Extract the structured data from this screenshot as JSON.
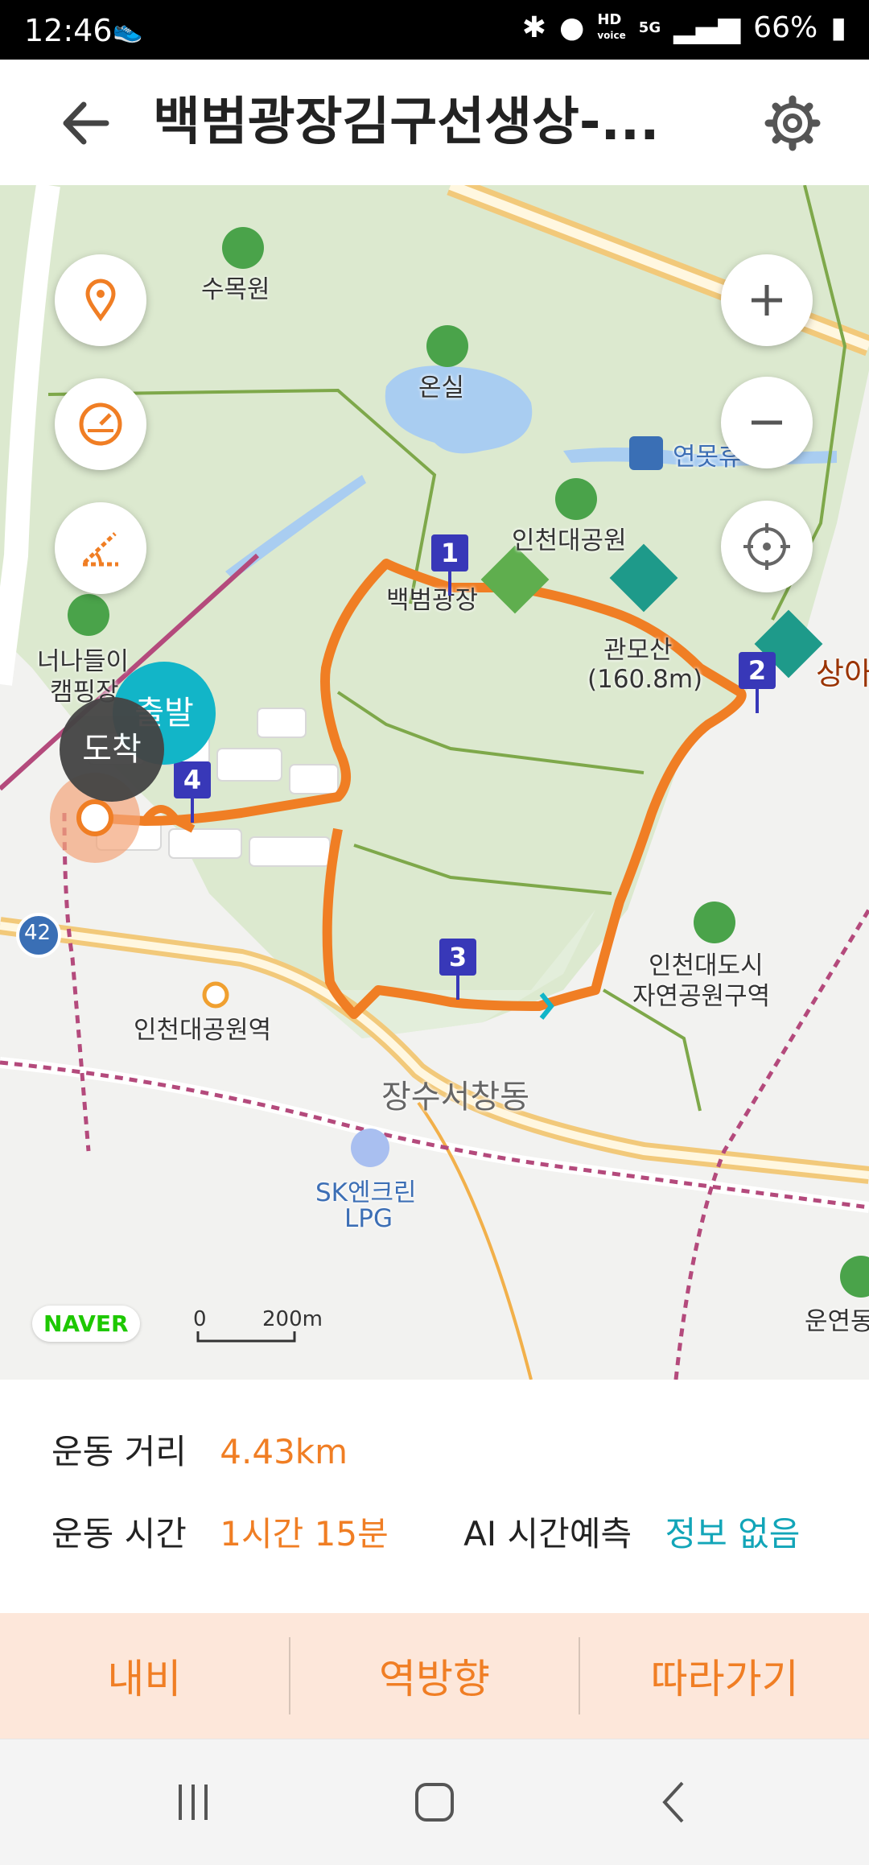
{
  "status_bar": {
    "time": "12:46",
    "hd_label": "HD",
    "voice_label": "voice",
    "network_label": "5G",
    "battery": "66%"
  },
  "header": {
    "title": "백범광장김구선생상-..."
  },
  "map": {
    "labels": {
      "sumokwon": "수목원",
      "onsil": "온실",
      "yeonmot": "연못휴게소",
      "incheon_park": "인천대공원",
      "baekbeom": "백범광장",
      "gwanmosan": "관모산",
      "gwanmosan_height": "(160.8m)",
      "sangah": "상아",
      "neonadeuri": "너나들이",
      "camping": "캠핑장",
      "station": "인천대공원역",
      "jangsu": "장수서창동",
      "city_park_1": "인천대도시",
      "city_park_2": "자연공원구역",
      "sk_1": "SK엔크린",
      "sk_2": "LPG",
      "unyeon": "운연동",
      "road_42": "42"
    },
    "start_label": "출발",
    "end_label": "도착",
    "waypoints": [
      "1",
      "2",
      "3",
      "4"
    ],
    "naver_logo": "NAVER",
    "scale_zero": "0",
    "scale_distance": "200m",
    "route_color": "#f07e24"
  },
  "stats": {
    "distance_label": "운동 거리",
    "distance_value": "4.43km",
    "time_label": "운동 시간",
    "time_value": "1시간 15분",
    "ai_label": "AI 시간예측",
    "ai_value": "정보 없음"
  },
  "actions": {
    "navi": "내비",
    "reverse": "역방향",
    "follow": "따라가기"
  }
}
